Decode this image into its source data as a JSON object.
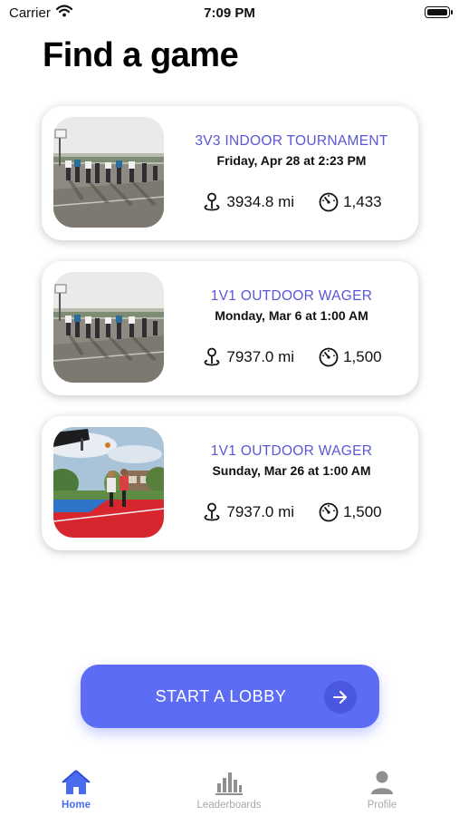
{
  "status_bar": {
    "carrier": "Carrier",
    "time": "7:09 PM"
  },
  "page": {
    "title": "Find a game"
  },
  "games": [
    {
      "title": "3V3 INDOOR TOURNAMENT",
      "date": "Friday, Apr 28 at 2:23 PM",
      "distance": "3934.8 mi",
      "rating": "1,433",
      "image": "outdoor-court-photo"
    },
    {
      "title": "1V1 OUTDOOR WAGER",
      "date": "Monday, Mar 6 at 1:00 AM",
      "distance": "7937.0 mi",
      "rating": "1,500",
      "image": "outdoor-court-photo"
    },
    {
      "title": "1V1 OUTDOOR WAGER",
      "date": "Sunday, Mar 26 at 1:00 AM",
      "distance": "7937.0 mi",
      "rating": "1,500",
      "image": "red-court-photo"
    }
  ],
  "lobby_button": {
    "label": "START A LOBBY",
    "icon": "arrow-right-icon"
  },
  "tabs": [
    {
      "label": "Home",
      "icon": "home-icon",
      "active": true
    },
    {
      "label": "Leaderboards",
      "icon": "bar-chart-icon",
      "active": false
    },
    {
      "label": "Profile",
      "icon": "person-icon",
      "active": false
    }
  ],
  "colors": {
    "accent": "#5c6cf5",
    "title_purple": "#5b56d8",
    "tab_active": "#4a6cf0",
    "tab_inactive": "#a9a9a9"
  }
}
